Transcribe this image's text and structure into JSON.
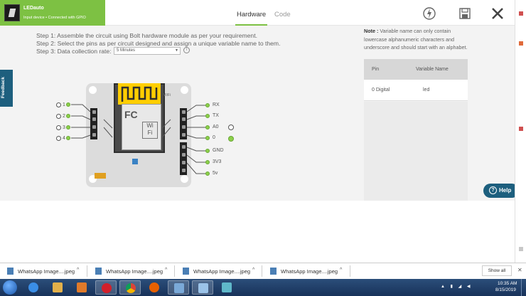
{
  "header": {
    "device_name": "LEDauto",
    "device_status": "Input device • Connected with GPIO",
    "tabs": [
      {
        "label": "Hardware",
        "active": true
      },
      {
        "label": "Code",
        "active": false
      }
    ],
    "icons": [
      "deploy-icon",
      "save-icon",
      "close-icon"
    ]
  },
  "steps": {
    "step1": "Step 1: Assemble the circuit using Bolt hardware module as per your requirement.",
    "step2": "Step 2: Select the pins as per circuit designed and assign a unique variable name to them.",
    "step3": "Step 3: Data collection rate:",
    "rate_value": "5 Minutes"
  },
  "feedback_label": "Feedback",
  "pins_left": [
    "1",
    "2",
    "3",
    "4"
  ],
  "pins_right": [
    "RX",
    "TX",
    "A0",
    "0",
    "GND",
    "3V3",
    "5v"
  ],
  "side_panel": {
    "note_label": "Note :",
    "note_text": "Variable name can only contain lowercase alphanumeric characters and underscore and should start with an alphabet.",
    "table": {
      "headers": [
        "Pin",
        "Variable Name"
      ],
      "rows": [
        {
          "pin": "0 Digital",
          "variable": "led"
        }
      ]
    }
  },
  "help_label": "Help",
  "downloads": {
    "items": [
      "WhatsApp Image....jpeg",
      "WhatsApp Image....jpeg",
      "WhatsApp Image....jpeg",
      "WhatsApp Image....jpeg"
    ],
    "show_all": "Show all"
  },
  "taskbar": {
    "time": "10:35 AM",
    "date": "8/15/2019"
  },
  "colors": {
    "accent_green": "#7dc143",
    "help_blue": "#1d5f7e",
    "antenna_yellow": "#ffce00"
  }
}
